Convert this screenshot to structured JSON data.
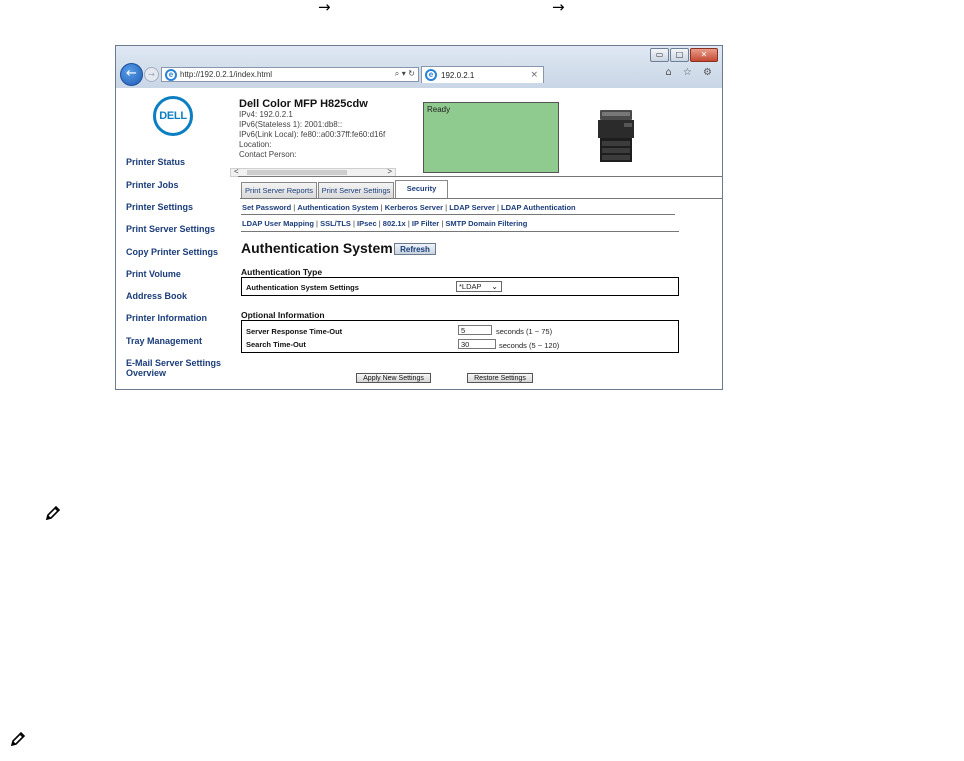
{
  "browser": {
    "url": "http://192.0.2.1/index.html",
    "tab_title": "192.0.2.1",
    "addr_tools": "⌕ ▾ ↻",
    "tab_close": "×",
    "toolbar_icons": "⌂ ☆ ⚙"
  },
  "window_controls": {
    "minimize": "▭",
    "maximize": "□",
    "close": "✕"
  },
  "logo_text": "DELL",
  "sidebar": {
    "items": [
      "Printer Status",
      "Printer Jobs",
      "Printer Settings",
      "Print Server Settings",
      "Copy Printer Settings",
      "Print Volume",
      "Address Book",
      "Printer Information",
      "Tray Management",
      "E-Mail Server Settings",
      "Overview"
    ]
  },
  "device": {
    "model": "Dell Color MFP H825cdw",
    "ipv4": "IPv4: 192.0.2.1",
    "ipv6_stateless": "IPv6(Stateless 1): 2001:db8::",
    "ipv6_link": "IPv6(Link Local): fe80::a00:37ff:fe60:d16f",
    "location": "Location:",
    "contact": "Contact Person:",
    "status": "Ready"
  },
  "tabs": [
    "Print Server Reports",
    "Print Server Settings",
    "Security"
  ],
  "sublinks": {
    "row1": [
      "Set Password",
      "Authentication System",
      "Kerberos Server",
      "LDAP Server",
      "LDAP Authentication"
    ],
    "row2": [
      "LDAP User Mapping",
      "SSL/TLS",
      "IPsec",
      "802.1x",
      "IP Filter",
      "SMTP Domain Filtering"
    ],
    "separator": " | "
  },
  "page": {
    "title": "Authentication System -",
    "refresh": "Refresh"
  },
  "auth_type": {
    "section": "Authentication Type",
    "label": "Authentication System Settings",
    "value": "*LDAP"
  },
  "optional": {
    "section": "Optional Information",
    "response_label": "Server Response Time-Out",
    "response_value": "5",
    "response_unit": "seconds (1 ~ 75)",
    "search_label": "Search Time-Out",
    "search_value": "30",
    "search_unit": "seconds (5 ~ 120)"
  },
  "buttons": {
    "apply": "Apply New Settings",
    "restore": "Restore Settings"
  },
  "doc_arrows": [
    "→",
    "→"
  ]
}
